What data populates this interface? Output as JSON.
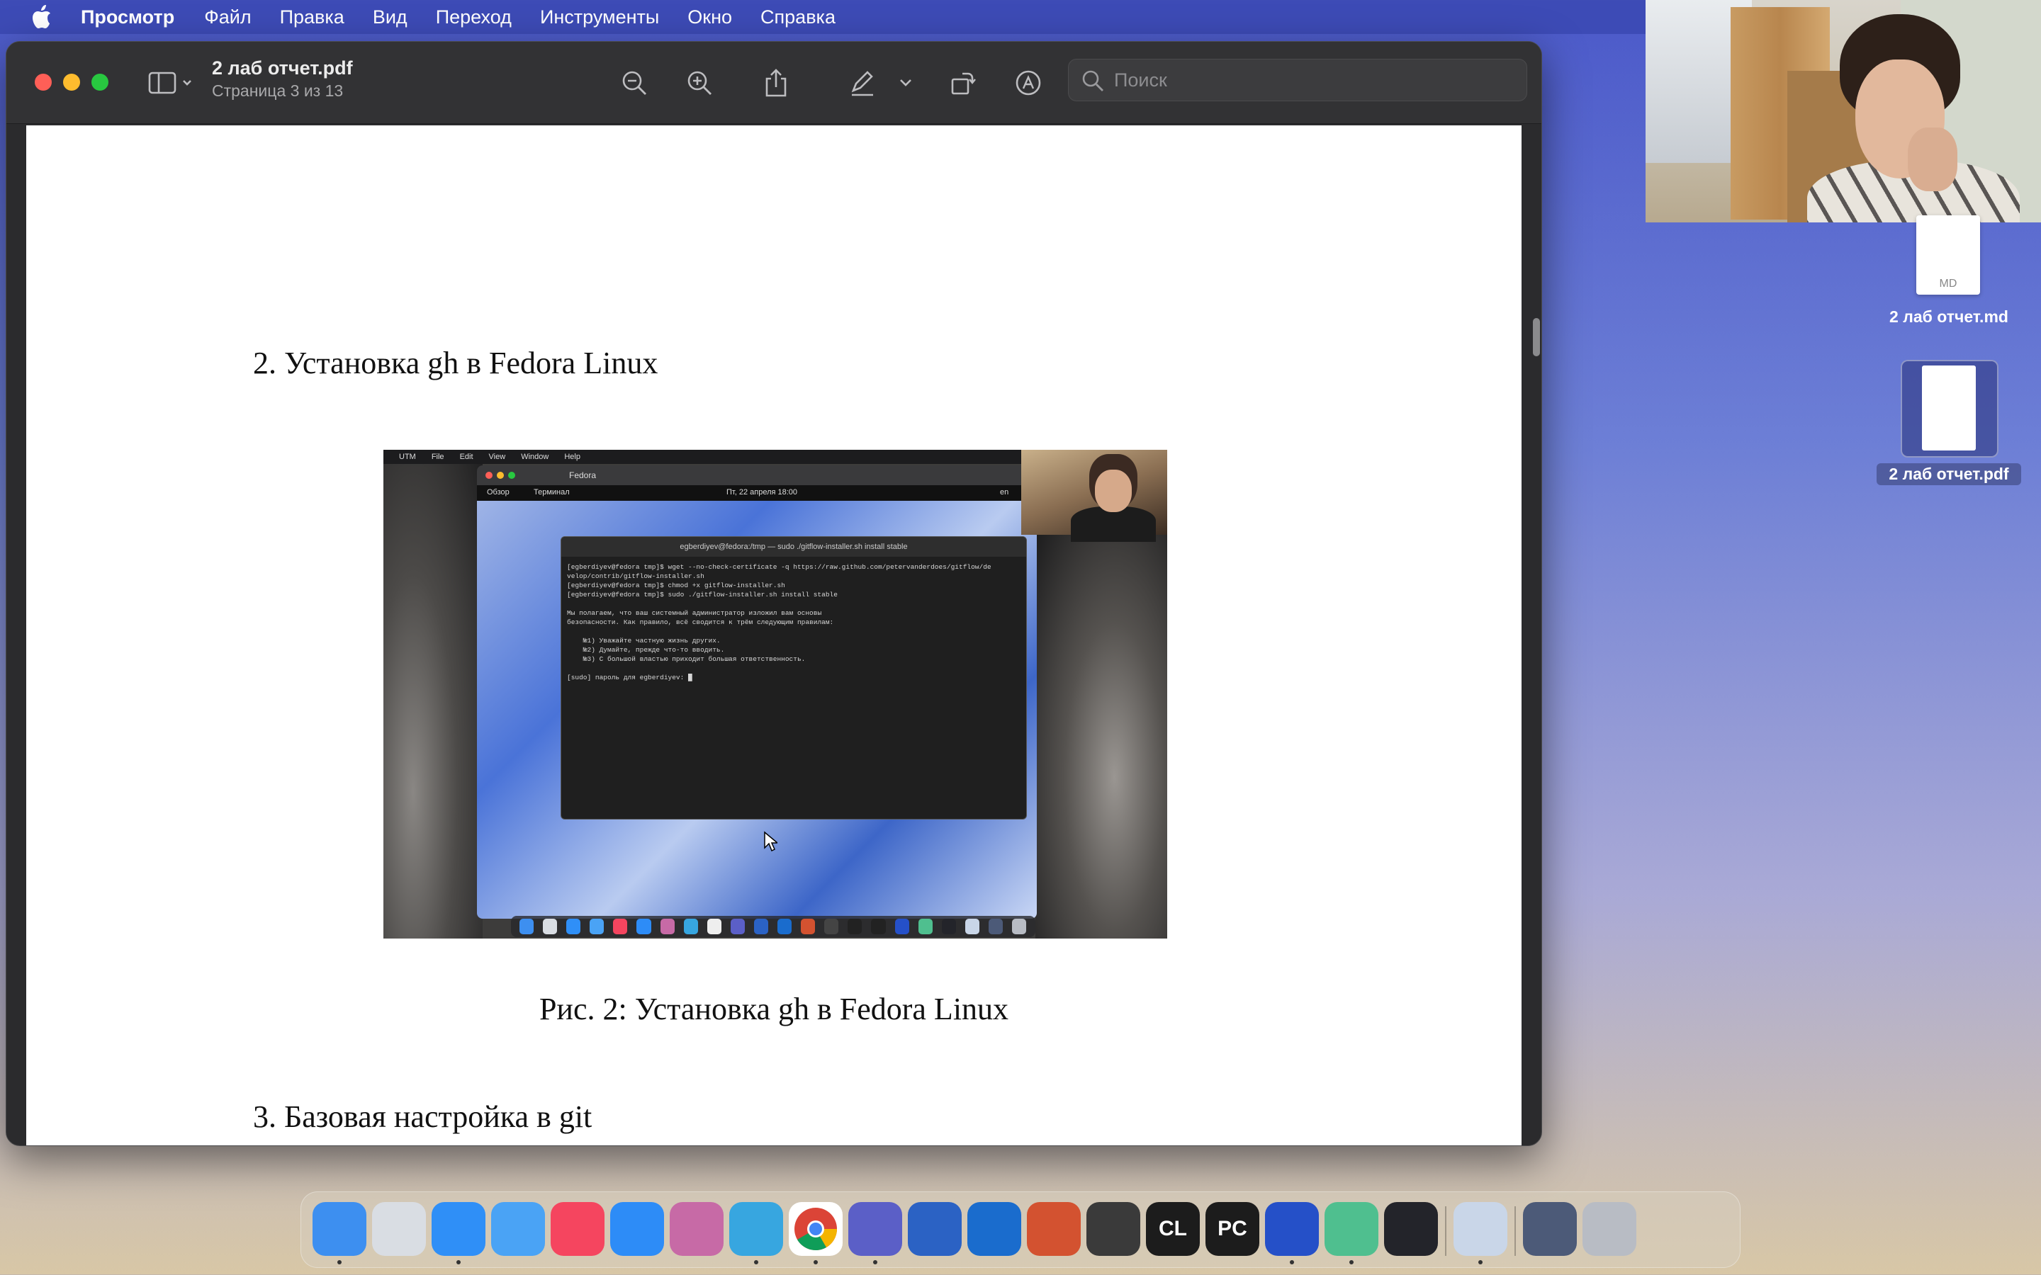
{
  "menubar": {
    "app": "Просмотр",
    "items": [
      "Файл",
      "Правка",
      "Вид",
      "Переход",
      "Инструменты",
      "Окно",
      "Справка"
    ]
  },
  "window": {
    "title": "2 лаб отчет.pdf",
    "subtitle": "Страница 3 из 13",
    "search_placeholder": "Поиск"
  },
  "document": {
    "heading_2": "2.  Установка gh в Fedora Linux",
    "caption": "Рис. 2: Установка gh в Fedora Linux",
    "heading_3": "3.  Базовая настройка в git",
    "figure": {
      "host_menu": [
        "UTM",
        "File",
        "Edit",
        "View",
        "Window",
        "Help"
      ],
      "vm_title": "Fedora",
      "vm_overview": "Обзор",
      "vm_terminal": "Терминал",
      "vm_clock": "Пт, 22 апреля 18:00",
      "vm_lang": "en",
      "terminal_title": "egberdiyev@fedora:/tmp — sudo ./gitflow-installer.sh install stable",
      "terminal_lines": [
        "[egberdiyev@fedora tmp]$ wget --no-check-certificate -q https://raw.github.com/petervanderdoes/gitflow/de",
        "velop/contrib/gitflow-installer.sh",
        "[egberdiyev@fedora tmp]$ chmod +x gitflow-installer.sh",
        "[egberdiyev@fedora tmp]$ sudo ./gitflow-installer.sh install stable",
        "",
        "Мы полагаем, что ваш системный администратор изложил вам основы",
        "безопасности. Как правило, всё сводится к трём следующим правилам:",
        "",
        "    №1) Уважайте частную жизнь других.",
        "    №2) Думайте, прежде что-то вводить.",
        "    №3) С большой властью приходит большая ответственность.",
        "",
        "[sudo] пароль для egberdiyev: █"
      ]
    }
  },
  "desktop_files": [
    {
      "name": "2 лаб отчет.md",
      "ext": "MD"
    },
    {
      "name": "2 лаб отчет.pdf"
    }
  ],
  "dock": [
    {
      "name": "Finder",
      "color": "#3d8ff0"
    },
    {
      "name": "Launchpad",
      "color": "#d9dde3"
    },
    {
      "name": "Safari",
      "color": "#2f8ff7"
    },
    {
      "name": "Mail",
      "color": "#4aa3f5"
    },
    {
      "name": "Music",
      "color": "#f5455f"
    },
    {
      "name": "App Store",
      "color": "#2d8cf7"
    },
    {
      "name": "Gitbook",
      "color": "#c76aa6"
    },
    {
      "name": "Telegram",
      "color": "#37a6e0"
    },
    {
      "name": "Chrome",
      "color": "#ffffff"
    },
    {
      "name": "Teams",
      "color": "#5b5fc7"
    },
    {
      "name": "Word",
      "color": "#2b62c4"
    },
    {
      "name": "Outlook",
      "color": "#1a6ccd"
    },
    {
      "name": "PowerPoint",
      "color": "#d35230"
    },
    {
      "name": "Disk Utility",
      "color": "#3a3a3a"
    },
    {
      "name": "CLion",
      "color": "#1c1c1c",
      "text": "CL"
    },
    {
      "name": "PyCharm",
      "color": "#1c1c1c",
      "text": "PC"
    },
    {
      "name": "UTM",
      "color": "#2550c8"
    },
    {
      "name": "Zettlr",
      "color": "#4fbf8f"
    },
    {
      "name": "OBS",
      "color": "#23242a"
    },
    {
      "name": "Preview",
      "color": "#c9d6e8"
    },
    {
      "name": "Downloads",
      "color": "#4c5a78"
    },
    {
      "name": "Trash",
      "color": "#b8bcc4"
    }
  ]
}
